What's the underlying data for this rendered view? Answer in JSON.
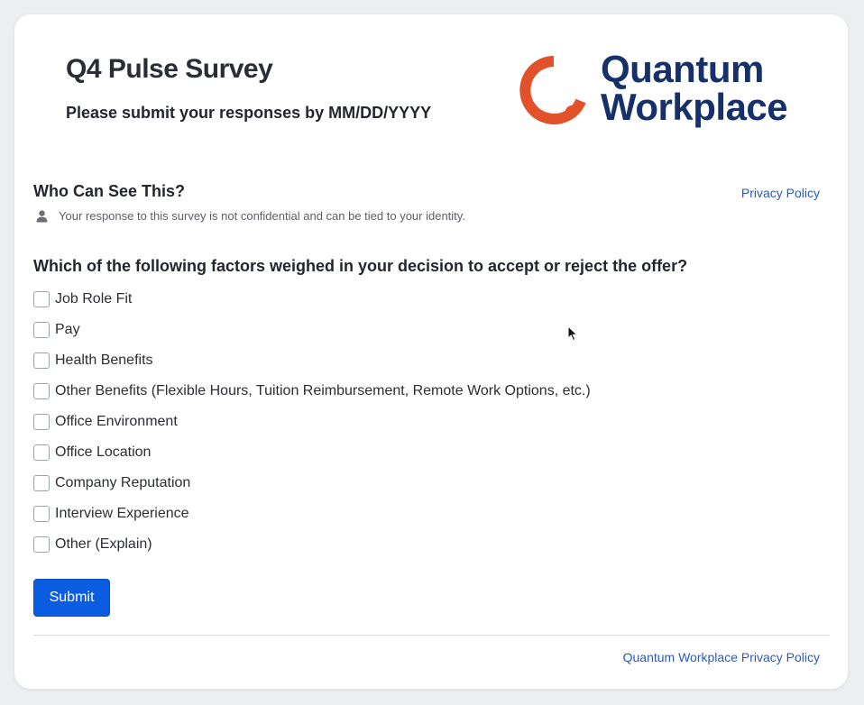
{
  "header": {
    "title": "Q4 Pulse Survey",
    "subtitle": "Please submit your responses by MM/DD/YYYY"
  },
  "logo": {
    "line1": "Quantum",
    "line2": "Workplace",
    "ring_color": "#e2522a",
    "text_color": "#16306a"
  },
  "visibility": {
    "heading": "Who Can See This?",
    "privacy_link": "Privacy Policy",
    "icon": "person-icon",
    "note": "Your response to this survey is not confidential and can be tied to your identity."
  },
  "question": {
    "text": "Which of the following factors weighed in your decision to accept or reject the offer?",
    "options": [
      {
        "label": "Job Role Fit",
        "checked": false
      },
      {
        "label": "Pay",
        "checked": false
      },
      {
        "label": "Health Benefits",
        "checked": false
      },
      {
        "label": "Other Benefits (Flexible Hours, Tuition Reimbursement, Remote Work Options, etc.)",
        "checked": false
      },
      {
        "label": "Office Environment",
        "checked": false
      },
      {
        "label": "Office Location",
        "checked": false
      },
      {
        "label": "Company Reputation",
        "checked": false
      },
      {
        "label": "Interview Experience",
        "checked": false
      },
      {
        "label": "Other (Explain)",
        "checked": false
      }
    ]
  },
  "actions": {
    "submit_label": "Submit",
    "submit_color": "#0a5ce0"
  },
  "footer": {
    "privacy_link": "Quantum Workplace Privacy Policy"
  },
  "colors": {
    "link": "#2a5bb8",
    "background": "#eceeef"
  }
}
